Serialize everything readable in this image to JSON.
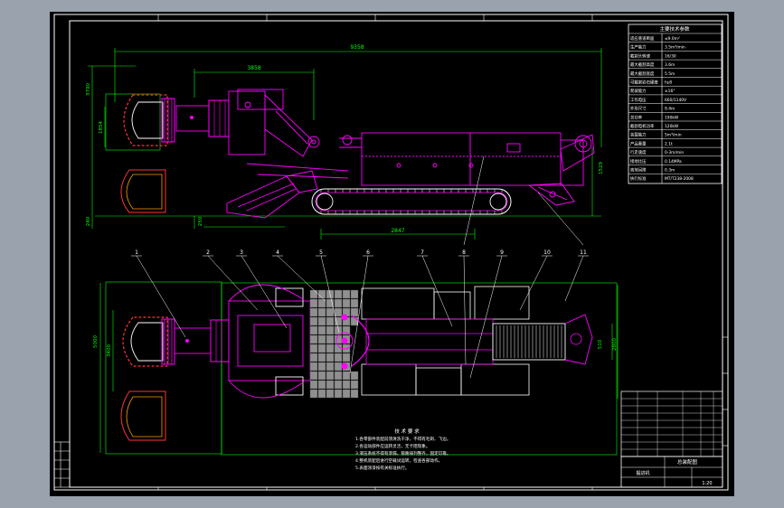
{
  "drawing": {
    "background_color": "#000000",
    "frame_color": "#ffffff",
    "outline_color": "#ff00ff",
    "dimension_color": "#00ff00",
    "cutter_color": "#ff3333",
    "track_color": "#ffffff"
  },
  "side_view": {
    "dim_overall_length": "9358",
    "dim_cutter_reach": "3858",
    "dim_track_span": "2847",
    "dim_height_left": "3790",
    "dim_height_mid": "1854",
    "dim_ground_left": "240",
    "dim_ground_mid": "250",
    "dim_right_height": "1529"
  },
  "plan_view": {
    "dim_total_width": "5000",
    "dim_head_width": "3400",
    "dim_rear_width": "2800",
    "dim_rear_small": "510"
  },
  "callouts": [
    "1",
    "2",
    "3",
    "4",
    "5",
    "6",
    "7",
    "8",
    "9",
    "10",
    "11"
  ],
  "spec_table": {
    "title": "主要技术参数",
    "rows": [
      {
        "label": "适应巷道断面",
        "value": "≤9.0m²"
      },
      {
        "label": "生产能力",
        "value": "3.5m³/min"
      },
      {
        "label": "截割头转速",
        "value": "16/30"
      },
      {
        "label": "最大截割高度",
        "value": "3.6m"
      },
      {
        "label": "最大截割宽度",
        "value": "5.5m"
      },
      {
        "label": "可截割岩石硬度",
        "value": "f≤8"
      },
      {
        "label": "爬坡能力",
        "value": "±16°"
      },
      {
        "label": "工作电压",
        "value": "660/1140V"
      },
      {
        "label": "外形尺寸",
        "value": "9.4m"
      },
      {
        "label": "总功率",
        "value": "190kW"
      },
      {
        "label": "截割电机功率",
        "value": "120kW"
      },
      {
        "label": "装载能力",
        "value": "5m³/min"
      },
      {
        "label": "产品重量",
        "value": "2.1t"
      },
      {
        "label": "行走速度",
        "value": "0-3m/min"
      },
      {
        "label": "接地比压",
        "value": "0.14MPa"
      },
      {
        "label": "离地间隙",
        "value": "0.3m"
      },
      {
        "label": "执行标准",
        "value": "MT/T238-2008"
      }
    ]
  },
  "notes": {
    "title": "技 术 要 求",
    "lines": [
      "1.各零部件装配前须清洗干净，不得有毛刺、飞边。",
      "2.各运动部件应运转灵活，无卡阻现象。",
      "3.液压系统不得有渗漏，管路排列整齐，固定可靠。",
      "4.整机装配后进行空载试运转，检查各部动作。",
      "5.表面涂漆按有关标准执行。"
    ]
  },
  "title_block": {
    "drawing_name": "总装配图",
    "company": "掘进机",
    "scale": "1:20"
  }
}
